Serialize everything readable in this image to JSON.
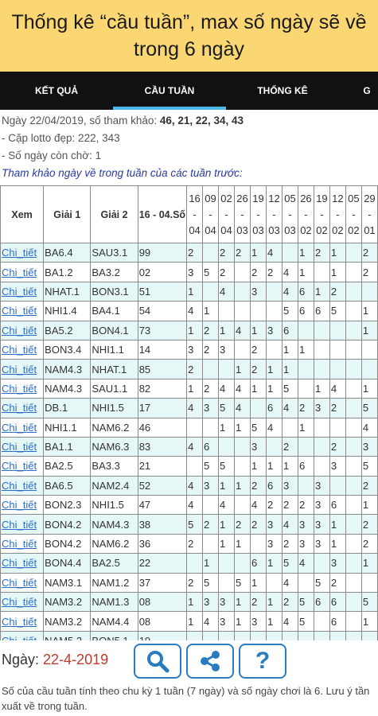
{
  "banner": {
    "title": "Thống kê “cầu tuần”, max số ngày sẽ về trong 6 ngày"
  },
  "tabs": [
    {
      "label": "KẾT QUẢ",
      "active": false
    },
    {
      "label": "CẦU TUẦN",
      "active": true
    },
    {
      "label": "THỐNG KÊ",
      "active": false
    },
    {
      "label": "G",
      "active": false
    }
  ],
  "info": {
    "line1_prefix": "Ngày 22/04/2019, số tham khảo: ",
    "line1_numbers": "46, 21, 22, 34, 43",
    "line2": "- Cặp lotto đẹp: 222, 343",
    "line3": "- Số ngày còn chờ: 1",
    "line4": "Tham khảo ngày về trong tuần của các tuần trước:"
  },
  "table": {
    "headers": {
      "xem": "Xem",
      "giai1": "Giải 1",
      "giai2": "Giải 2",
      "so": "16 - 04.Số"
    },
    "date_headers": [
      [
        "16",
        "-",
        "04"
      ],
      [
        "09",
        "-",
        "04"
      ],
      [
        "02",
        "-",
        "04"
      ],
      [
        "26",
        "-",
        "03"
      ],
      [
        "19",
        "-",
        "03"
      ],
      [
        "12",
        "-",
        "03"
      ],
      [
        "05",
        "-",
        "03"
      ],
      [
        "26",
        "-",
        "02"
      ],
      [
        "19",
        "-",
        "02"
      ],
      [
        "12",
        "-",
        "02"
      ],
      [
        "05",
        "-",
        "02"
      ],
      [
        "29",
        "-",
        "01"
      ]
    ],
    "rows": [
      [
        "Chi_tiết",
        "BA6.4",
        "SAU3.1",
        "99",
        "2",
        "",
        "2",
        "2",
        "1",
        "4",
        "",
        "1",
        "2",
        "1",
        "",
        "2"
      ],
      [
        "Chi_tiết",
        "BA1.2",
        "BA3.2",
        "02",
        "3",
        "5",
        "2",
        "",
        "2",
        "2",
        "4",
        "1",
        "",
        "1",
        "",
        "2"
      ],
      [
        "Chi_tiết",
        "NHAT.1",
        "BON3.1",
        "51",
        "1",
        "",
        "4",
        "",
        "3",
        "",
        "4",
        "6",
        "1",
        "2",
        "",
        ""
      ],
      [
        "Chi_tiết",
        "NHI1.4",
        "BA4.1",
        "54",
        "4",
        "1",
        "",
        "",
        "",
        "",
        "5",
        "6",
        "6",
        "5",
        "",
        "1"
      ],
      [
        "Chi_tiết",
        "BA5.2",
        "BON4.1",
        "73",
        "1",
        "2",
        "1",
        "4",
        "1",
        "3",
        "6",
        "",
        "",
        "",
        "",
        "1"
      ],
      [
        "Chi_tiết",
        "BON3.4",
        "NHI1.1",
        "14",
        "3",
        "2",
        "3",
        "",
        "2",
        "",
        "1",
        "1",
        "",
        "",
        "",
        ""
      ],
      [
        "Chi_tiết",
        "NAM4.3",
        "NHAT.1",
        "85",
        "2",
        "",
        "",
        "1",
        "2",
        "1",
        "1",
        "",
        "",
        "",
        "",
        ""
      ],
      [
        "Chi_tiết",
        "NAM4.3",
        "SAU1.1",
        "82",
        "1",
        "2",
        "4",
        "4",
        "1",
        "1",
        "5",
        "",
        "1",
        "4",
        "",
        "1"
      ],
      [
        "Chi_tiết",
        "DB.1",
        "NHI1.5",
        "17",
        "4",
        "3",
        "5",
        "4",
        "",
        "6",
        "4",
        "2",
        "3",
        "2",
        "",
        "5"
      ],
      [
        "Chi_tiết",
        "NHI1.1",
        "NAM6.2",
        "46",
        "",
        "",
        "1",
        "1",
        "5",
        "4",
        "",
        "1",
        "",
        "",
        "",
        "4"
      ],
      [
        "Chi_tiết",
        "BA1.1",
        "NAM6.3",
        "83",
        "4",
        "6",
        "",
        "",
        "3",
        "",
        "2",
        "",
        "",
        "2",
        "",
        "3"
      ],
      [
        "Chi_tiết",
        "BA2.5",
        "BA3.3",
        "21",
        "",
        "5",
        "5",
        "",
        "1",
        "1",
        "1",
        "6",
        "",
        "3",
        "",
        "5"
      ],
      [
        "Chi_tiết",
        "BA6.5",
        "NAM2.4",
        "52",
        "4",
        "3",
        "1",
        "1",
        "2",
        "6",
        "3",
        "",
        "3",
        "",
        "",
        "2"
      ],
      [
        "Chi_tiết",
        "BON2.3",
        "NHI1.5",
        "47",
        "4",
        "",
        "4",
        "",
        "4",
        "2",
        "2",
        "2",
        "3",
        "6",
        "",
        "1"
      ],
      [
        "Chi_tiết",
        "BON4.2",
        "NAM4.3",
        "38",
        "5",
        "2",
        "1",
        "2",
        "2",
        "3",
        "4",
        "3",
        "3",
        "1",
        "",
        "2"
      ],
      [
        "Chi_tiết",
        "BON4.2",
        "NAM6.2",
        "36",
        "2",
        "",
        "1",
        "1",
        "",
        "3",
        "2",
        "3",
        "3",
        "1",
        "",
        "2"
      ],
      [
        "Chi_tiết",
        "BON4.4",
        "BA2.5",
        "22",
        "",
        "1",
        "",
        "",
        "6",
        "1",
        "5",
        "4",
        "",
        "3",
        "",
        "1"
      ],
      [
        "Chi_tiết",
        "NAM3.1",
        "NAM1.2",
        "37",
        "2",
        "5",
        "",
        "5",
        "1",
        "",
        "4",
        "",
        "5",
        "2",
        "",
        ""
      ],
      [
        "Chi_tiết",
        "NAM3.2",
        "NAM1.3",
        "08",
        "1",
        "3",
        "3",
        "1",
        "2",
        "1",
        "2",
        "5",
        "6",
        "6",
        "",
        "5"
      ],
      [
        "Chi_tiết",
        "NAM3.2",
        "NAM4.4",
        "08",
        "1",
        "4",
        "3",
        "1",
        "3",
        "1",
        "4",
        "5",
        "",
        "6",
        "",
        "1"
      ],
      [
        "Chi_tiết",
        "NAM5.2",
        "BON5.1",
        "19",
        "",
        "",
        "",
        "",
        "",
        "",
        "",
        "",
        "",
        "",
        "",
        ""
      ]
    ]
  },
  "footer": {
    "date_label": "Ngày: ",
    "date_value": "22-4-2019",
    "note": "Số của cầu tuần tính theo chu kỳ 1 tuần (7 ngày) và số ngày chơi là 6. Lưu ý tần xuất về trong tuần."
  },
  "icons": {
    "search": "search-icon",
    "share": "share-icon",
    "help": "help-icon"
  },
  "colors": {
    "banner": "#fbd773",
    "tab_indicator": "#4cb8e6",
    "link": "#2a6fc7",
    "row_alt": "#e6f7f8",
    "date": "#c0392b"
  }
}
